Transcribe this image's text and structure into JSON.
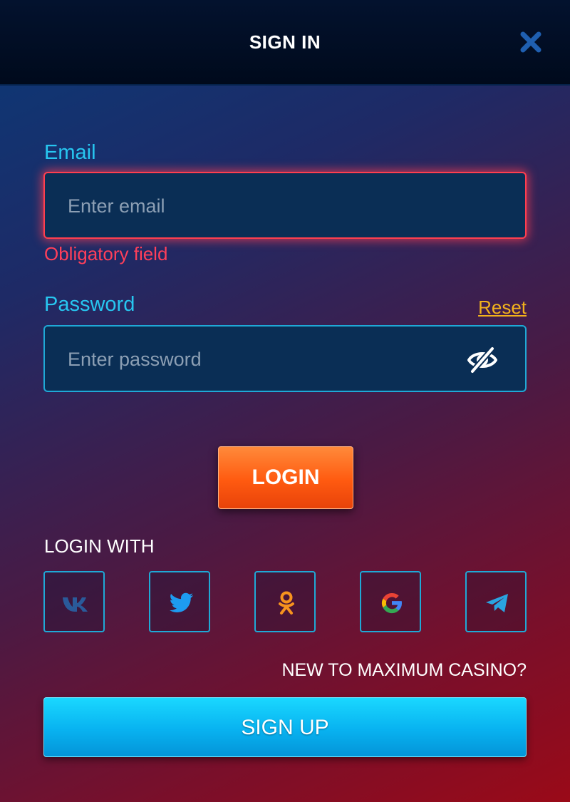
{
  "header": {
    "title": "SIGN IN",
    "close_icon": "close-icon"
  },
  "email": {
    "label": "Email",
    "placeholder": "Enter email",
    "value": "",
    "error": "Obligatory field"
  },
  "password": {
    "label": "Password",
    "placeholder": "Enter password",
    "value": "",
    "reset_label": "Reset",
    "toggle_icon": "eye-off-icon"
  },
  "login": {
    "button_label": "LOGIN"
  },
  "social": {
    "heading": "LOGIN WITH",
    "providers": [
      {
        "name": "VK",
        "icon": "vk-icon",
        "color": "#2a5a9a"
      },
      {
        "name": "Twitter",
        "icon": "twitter-icon",
        "color": "#1d9bf0"
      },
      {
        "name": "Odnoklassniki",
        "icon": "odnoklassniki-icon",
        "color": "#f7931e"
      },
      {
        "name": "Google",
        "icon": "google-icon",
        "color": "#4285f4"
      },
      {
        "name": "Telegram",
        "icon": "telegram-icon",
        "color": "#2aa3e0"
      }
    ]
  },
  "signup": {
    "prompt": "NEW TO MAXIMUM CASINO?",
    "button_label": "SIGN UP"
  },
  "colors": {
    "accent_cyan": "#27c6f0",
    "error_red": "#ff3f5a",
    "reset_gold": "#f2b21c",
    "login_orange": "#ff5a10",
    "signup_blue": "#08b2f0"
  }
}
